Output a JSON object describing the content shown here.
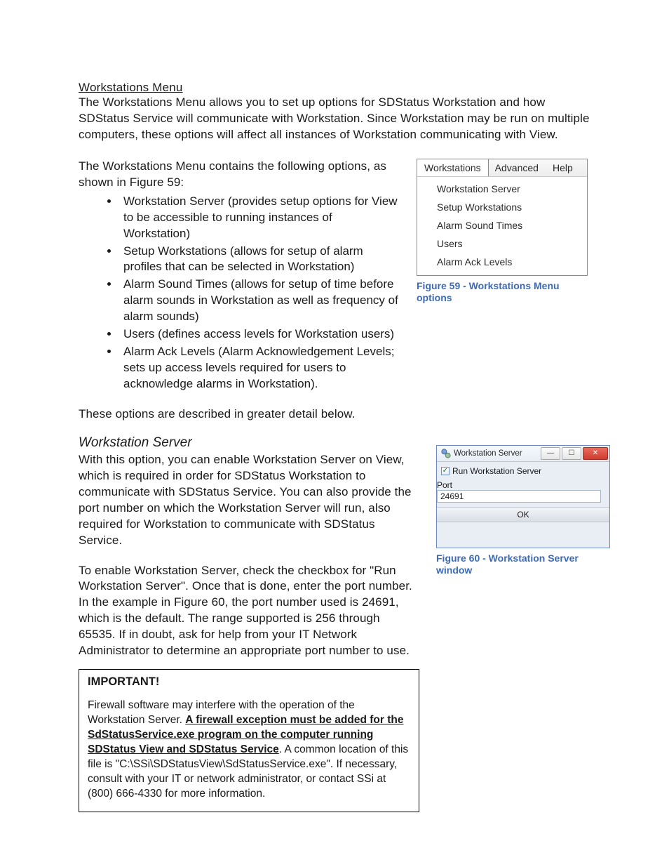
{
  "heading": "Workstations Menu",
  "intro": "The Workstations Menu allows you to set up options for SDStatus Workstation and how SDStatus Service will communicate with Workstation. Since Workstation may be run on multiple computers, these options will affect all instances of Workstation communicating with View.",
  "list_intro": "The Workstations Menu contains the following options, as shown in Figure 59:",
  "bullets": [
    "Workstation Server (provides setup options for View to be accessible to running instances of Workstation)",
    "Setup Workstations (allows for setup of alarm profiles that can be selected in Workstation)",
    "Alarm Sound Times (allows for setup of time before alarm sounds in Workstation as well as frequency of alarm sounds)",
    "Users (defines access levels for Workstation users)",
    "Alarm Ack Levels (Alarm Acknowledgement Levels; sets up access levels required for users to acknowledge alarms in Workstation)."
  ],
  "bullets_outro": "These options are described in greater detail below.",
  "subheading": "Workstation Server",
  "ws_para1": "With this option, you can enable Workstation Server on View, which is required in order for SDStatus Workstation to communicate with SDStatus Service. You can also provide the port number on which the Workstation Server will run, also required for Workstation to communicate with SDStatus Service.",
  "ws_para2": "To enable Workstation Server, check the checkbox for \"Run Workstation Server\". Once that is done, enter the port number. In the example in Figure 60, the port number used is 24691, which is the default. The range supported is 256 through 65535. If in doubt, ask for help from your IT Network Administrator to determine an appropriate port number to use.",
  "menu": {
    "tabs": [
      "Workstations",
      "Advanced",
      "Help"
    ],
    "items": [
      "Workstation Server",
      "Setup Workstations",
      "Alarm Sound Times",
      "Users",
      "Alarm Ack Levels"
    ]
  },
  "fig59_caption": "Figure 59 - Workstations Menu options",
  "win": {
    "title": "Workstation Server",
    "checkbox_label": "Run Workstation Server",
    "checkbox_checked": "✓",
    "port_label": "Port",
    "port_value": "24691",
    "ok_label": "OK",
    "min_glyph": "—",
    "max_glyph": "☐",
    "close_glyph": "✕"
  },
  "fig60_caption": "Figure 60 - Workstation Server window",
  "important": {
    "title": "IMPORTANT!",
    "lead": "Firewall software may interfere with the operation of the Workstation Server. ",
    "bold_underlined": "A firewall exception must be added for the SdStatusService.exe program on the computer running SDStatus View and SDStatus Service",
    "tail": ". A common location of this file is \"C:\\SSi\\SDStatusView\\SdStatusService.exe\". If necessary, consult with your IT or network administrator, or contact SSi at (800) 666-4330 for more information."
  }
}
